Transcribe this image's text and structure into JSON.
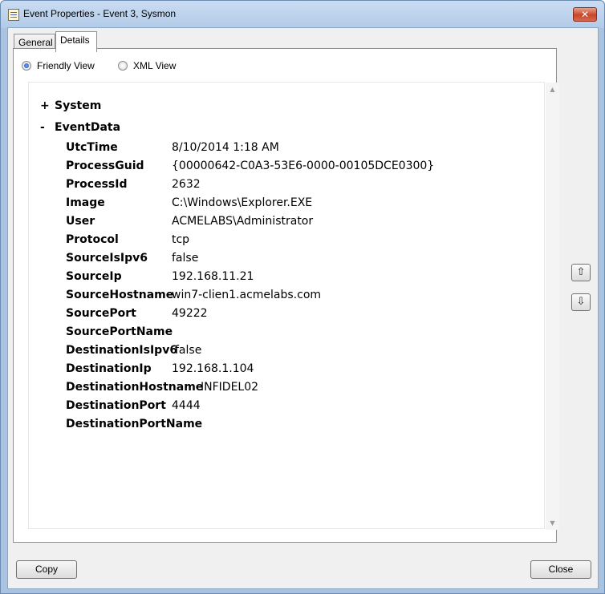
{
  "window": {
    "title": "Event Properties - Event 3, Sysmon",
    "close_glyph": "✕"
  },
  "tabs": [
    {
      "label": "General",
      "active": false
    },
    {
      "label": "Details",
      "active": true
    }
  ],
  "view_options": {
    "friendly": {
      "label": "Friendly View",
      "selected": true
    },
    "xml": {
      "label": "XML View",
      "selected": false
    }
  },
  "tree": {
    "system": {
      "sign": "+",
      "label": "System"
    },
    "eventdata": {
      "sign": "-",
      "label": "EventData"
    }
  },
  "fields": [
    {
      "key": "UtcTime",
      "value": "8/10/2014 1:18 AM"
    },
    {
      "key": "ProcessGuid",
      "value": "{00000642-C0A3-53E6-0000-00105DCE0300}"
    },
    {
      "key": "ProcessId",
      "value": "2632"
    },
    {
      "key": "Image",
      "value": "C:\\Windows\\Explorer.EXE"
    },
    {
      "key": "User",
      "value": "ACMELABS\\Administrator"
    },
    {
      "key": "Protocol",
      "value": "tcp"
    },
    {
      "key": "SourceIsIpv6",
      "value": "false"
    },
    {
      "key": "SourceIp",
      "value": "192.168.11.21"
    },
    {
      "key": "SourceHostname",
      "value": "win7-clien1.acmelabs.com"
    },
    {
      "key": "SourcePort",
      "value": "49222"
    },
    {
      "key": "SourcePortName",
      "value": ""
    },
    {
      "key": "DestinationIsIpv6",
      "value": "false"
    },
    {
      "key": "DestinationIp",
      "value": "192.168.1.104"
    },
    {
      "key": "DestinationHostname",
      "value": "INFIDEL02"
    },
    {
      "key": "DestinationPort",
      "value": "4444"
    },
    {
      "key": "DestinationPortName",
      "value": ""
    }
  ],
  "buttons": {
    "copy": "Copy",
    "close": "Close",
    "prev_glyph": "⇧",
    "next_glyph": "⇩"
  },
  "icons": {
    "app": "event-log-icon",
    "scroll_up": "scroll-up-icon",
    "scroll_down": "scroll-down-icon"
  }
}
